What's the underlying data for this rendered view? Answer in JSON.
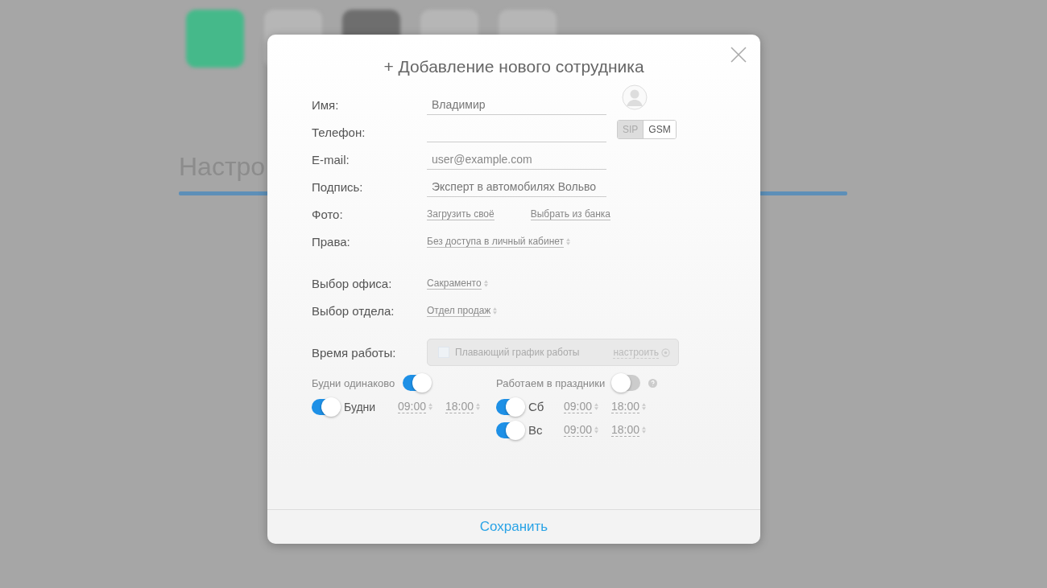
{
  "background": {
    "heading": "Настро"
  },
  "dialog": {
    "title": "+ Добавление нового сотрудника",
    "fields": [
      {
        "kind": "person",
        "label": "Имя:",
        "value": "Владимир"
      },
      {
        "kind": "phone",
        "label": "Телефон:",
        "options": [
          {
            "label": "SIP",
            "selected": false
          },
          {
            "label": "GSM",
            "selected": true
          }
        ]
      },
      {
        "kind": "text",
        "label": "E-mail:",
        "placeholder": "user@example.com"
      },
      {
        "kind": "text",
        "label": "Подпись:",
        "value": "Эксперт в автомобилях Вольво"
      },
      {
        "kind": "links",
        "label": "Фото:",
        "links": [
          "Загрузить своё",
          "Выбрать из банка"
        ]
      },
      {
        "kind": "select",
        "label": "Права:",
        "value": "Без доступа в личный кабинет"
      }
    ],
    "placement": [
      {
        "kind": "select",
        "label": "Выбор офиса:",
        "value": "Сакраменто"
      },
      {
        "kind": "select",
        "label": "Выбор отдела:",
        "value": "Отдел продаж"
      }
    ],
    "schedule": {
      "label": "Время работы:",
      "floating": {
        "label": "Плавающий график работы",
        "checked": false,
        "link": "настроить"
      },
      "weekdays_same": {
        "label": "Будни одинаково",
        "on": true
      },
      "holidays": {
        "label": "Работаем в праздники",
        "on": false
      },
      "weekdays": [
        {
          "label": "Будни",
          "on": true,
          "from": "09:00",
          "to": "18:00"
        }
      ],
      "weekend": [
        {
          "label": "Сб",
          "on": true,
          "from": "09:00",
          "to": "18:00"
        },
        {
          "label": "Вс",
          "on": true,
          "from": "09:00",
          "to": "18:00"
        }
      ]
    },
    "save": "Сохранить"
  }
}
